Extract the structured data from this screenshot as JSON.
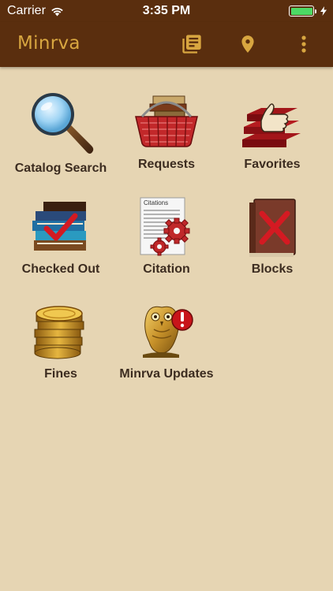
{
  "status": {
    "carrier": "Carrier",
    "time": "3:35 PM"
  },
  "app": {
    "title": "Minrva"
  },
  "toolbar": {
    "icons": [
      "library-books-icon",
      "location-pin-icon",
      "more-vert-icon"
    ]
  },
  "tiles": [
    {
      "label": "Catalog Search",
      "icon": "magnifier-icon"
    },
    {
      "label": "Requests",
      "icon": "book-basket-icon"
    },
    {
      "label": "Favorites",
      "icon": "thumbs-up-books-icon"
    },
    {
      "label": "Checked Out",
      "icon": "books-checkmark-icon"
    },
    {
      "label": "Citation",
      "icon": "citation-gears-icon"
    },
    {
      "label": "Blocks",
      "icon": "blocked-book-icon"
    },
    {
      "label": "Fines",
      "icon": "coin-stack-icon"
    },
    {
      "label": "Minrva Updates",
      "icon": "owl-alert-icon"
    }
  ],
  "citation_icon_text": "Citations",
  "colors": {
    "appbar": "#5a2e0e",
    "title": "#d8a640",
    "background": "#e6d5b3"
  }
}
